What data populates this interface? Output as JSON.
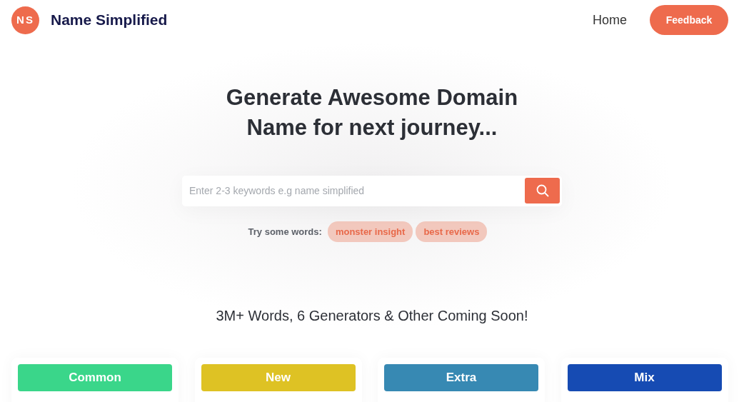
{
  "brand": {
    "logo": "NS",
    "name": "Name Simplified"
  },
  "nav": {
    "links": [
      "Home"
    ],
    "button": "Feedback"
  },
  "hero": {
    "title": "Generate Awesome Domain Name for next journey...",
    "search": {
      "placeholder": "Enter 2-3 keywords e.g name simplified"
    },
    "suggestions_label": "Try some words:",
    "suggestions": [
      "monster insight",
      "best reviews"
    ]
  },
  "subtitle": "3M+ Words, 6 Generators & Other Coming Soon!",
  "generators": [
    {
      "label": "Common",
      "color": "#3ad68a"
    },
    {
      "label": "New",
      "color": "#dec224"
    },
    {
      "label": "Extra",
      "color": "#3789b3"
    },
    {
      "label": "Mix",
      "color": "#164bb3"
    }
  ]
}
